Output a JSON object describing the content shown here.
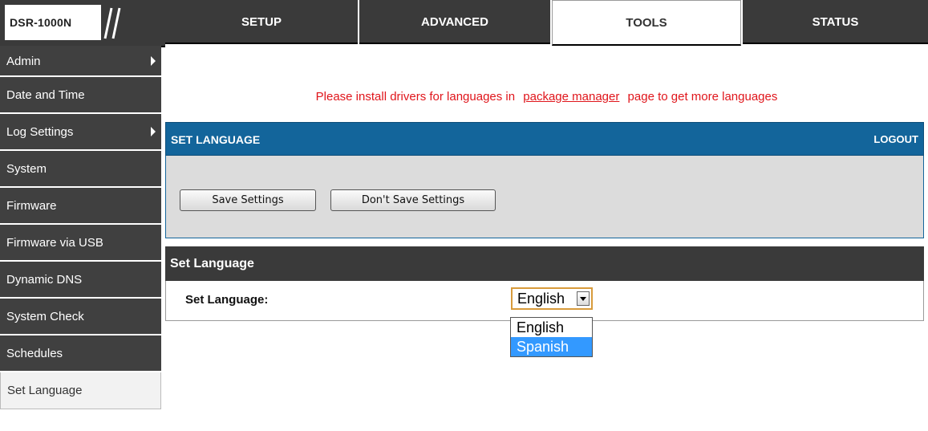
{
  "header": {
    "model": "DSR-1000N",
    "tabs": [
      {
        "label": "SETUP"
      },
      {
        "label": "ADVANCED"
      },
      {
        "label": "TOOLS"
      },
      {
        "label": "STATUS"
      }
    ],
    "active_tab": "TOOLS"
  },
  "sidebar": {
    "items": [
      {
        "label": "Admin",
        "has_submenu": true
      },
      {
        "label": "Date and Time",
        "has_submenu": false
      },
      {
        "label": "Log Settings",
        "has_submenu": true
      },
      {
        "label": "System",
        "has_submenu": false
      },
      {
        "label": "Firmware",
        "has_submenu": false
      },
      {
        "label": "Firmware via USB",
        "has_submenu": false
      },
      {
        "label": "Dynamic DNS",
        "has_submenu": false
      },
      {
        "label": "System Check",
        "has_submenu": false
      },
      {
        "label": "Schedules",
        "has_submenu": false
      },
      {
        "label": "Set Language",
        "has_submenu": false
      }
    ],
    "active_item": "Set Language"
  },
  "notice": {
    "before": "Please install drivers for languages in",
    "link": "package manager",
    "after": "page to get more languages"
  },
  "panel": {
    "title": "SET LANGUAGE",
    "logout": "LOGOUT",
    "save_label": "Save Settings",
    "dont_save_label": "Don't Save Settings"
  },
  "section": {
    "title": "Set Language",
    "field_label": "Set Language:",
    "selected_value": "English",
    "options": [
      "English",
      "Spanish"
    ],
    "highlighted_option": "Spanish"
  },
  "colors": {
    "nav_dark": "#3a3a3a",
    "panel_blue": "#13659b",
    "notice_red": "#e0151b",
    "highlight": "#3399ff"
  }
}
